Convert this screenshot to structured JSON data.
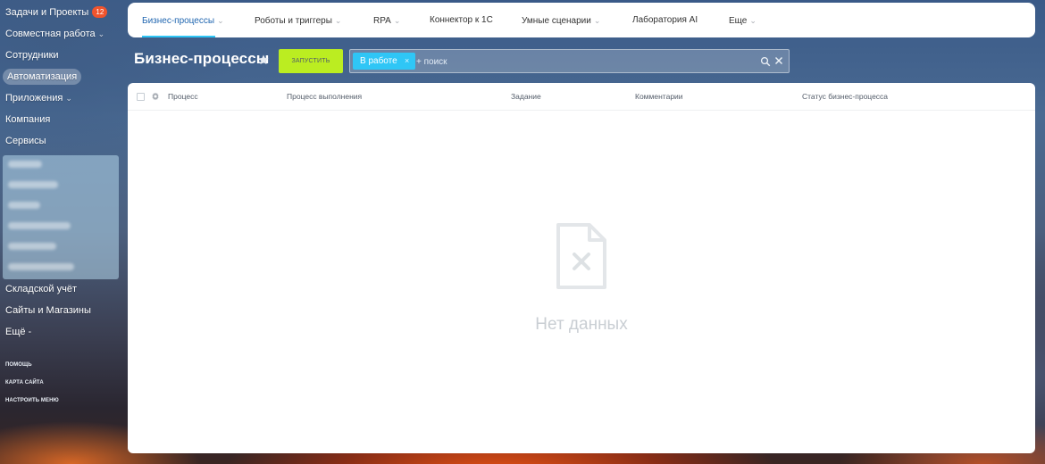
{
  "sidebar": {
    "items": [
      {
        "label": "Задачи и Проекты",
        "badge": "12"
      },
      {
        "label": "Совместная работа",
        "chevron": "⌄"
      },
      {
        "label": "Сотрудники"
      },
      {
        "label": "Автоматизация",
        "active": true
      },
      {
        "label": "Приложения",
        "chevron": "⌄"
      },
      {
        "label": "Компания"
      },
      {
        "label": "Сервисы"
      },
      {
        "label": "Складской учёт"
      },
      {
        "label": "Сайты и Магазины"
      },
      {
        "label": "Ещё -"
      }
    ],
    "footer_links": [
      "ПОМОЩЬ",
      "КАРТА САЙТА",
      "НАСТРОИТЬ МЕНЮ"
    ]
  },
  "topnav": {
    "tabs": [
      {
        "label": "Бизнес-процессы",
        "has_dropdown": true,
        "active": true
      },
      {
        "label": "Роботы и триггеры",
        "has_dropdown": true
      },
      {
        "label": "RPA",
        "has_dropdown": true
      },
      {
        "label": "Коннектор к 1С",
        "has_dropdown": false
      },
      {
        "label": "Умные сценарии",
        "has_dropdown": true
      },
      {
        "label": "Лаборатория AI",
        "has_dropdown": false
      },
      {
        "label": "Еще",
        "has_dropdown": true
      }
    ],
    "dropdown_glyph": "⌄"
  },
  "page": {
    "title": "Бизнес-процессы",
    "run_button": "ЗАПУСТИТЬ"
  },
  "filter": {
    "chip": "В работе",
    "chip_close": "×",
    "placeholder": "+ поиск"
  },
  "grid": {
    "columns": [
      "Процесс",
      "Процесс выполнения",
      "Задание",
      "Комментарии",
      "Статус бизнес-процесса"
    ],
    "empty_text": "Нет данных"
  },
  "colors": {
    "accent_green": "#bbed21",
    "accent_blue": "#2fc6f6",
    "active_tab_text": "#2066b0",
    "badge": "#f0542d"
  },
  "icons": {
    "star": "star-icon",
    "search": "search-icon",
    "clear": "close-icon",
    "settings": "gear-icon",
    "empty": "empty-file-icon"
  }
}
